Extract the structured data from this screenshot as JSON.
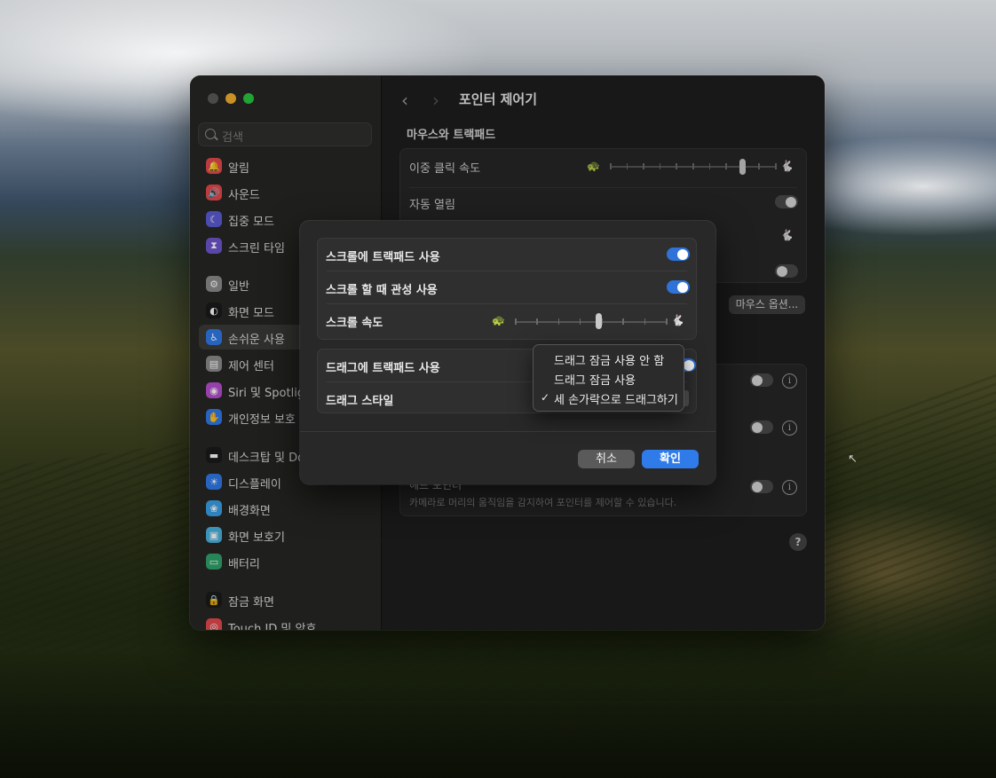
{
  "window": {
    "title": "포인터 제어기",
    "nav_back": "‹",
    "nav_forward": "›"
  },
  "sidebar": {
    "search_placeholder": "검색",
    "items": [
      {
        "label": "알림",
        "icon": "bell-icon",
        "color": "#e5484d"
      },
      {
        "label": "사운드",
        "icon": "speaker-icon",
        "color": "#e5484d"
      },
      {
        "label": "집중 모드",
        "icon": "moon-icon",
        "color": "#5b5bd6"
      },
      {
        "label": "스크린 타임",
        "icon": "hourglass-icon",
        "color": "#6e56cf"
      },
      {
        "label": "일반",
        "icon": "gear-icon",
        "color": "#8b8b8b"
      },
      {
        "label": "화면 모드",
        "icon": "appearance-icon",
        "color": "#1a1a1a"
      },
      {
        "label": "손쉬운 사용",
        "icon": "accessibility-icon",
        "color": "#2f7bea"
      },
      {
        "label": "제어 센터",
        "icon": "control-center-icon",
        "color": "#8b8b8b"
      },
      {
        "label": "Siri 및 Spotlight",
        "icon": "siri-icon",
        "color": "#b84fd1"
      },
      {
        "label": "개인정보 보호 및 보안",
        "icon": "hand-icon",
        "color": "#2f7bea"
      },
      {
        "label": "데스크탑 및 Dock",
        "icon": "dock-icon",
        "color": "#1a1a1a"
      },
      {
        "label": "디스플레이",
        "icon": "sun-icon",
        "color": "#2f7bea"
      },
      {
        "label": "배경화면",
        "icon": "wallpaper-icon",
        "color": "#3aa0e8"
      },
      {
        "label": "화면 보호기",
        "icon": "screensaver-icon",
        "color": "#4bb3e0"
      },
      {
        "label": "배터리",
        "icon": "battery-icon",
        "color": "#30a46c"
      },
      {
        "label": "잠금 화면",
        "icon": "lock-icon",
        "color": "#1a1a1a"
      },
      {
        "label": "Touch ID 및 암호",
        "icon": "fingerprint-icon",
        "color": "#e5484d"
      }
    ]
  },
  "main": {
    "section_title": "마우스와 트랙패드",
    "rows": {
      "double_click_speed": "이중 클릭 속도",
      "spring_loading": "자동 열림"
    },
    "mouse_options_button": "마우스 옵션...",
    "head_pointer_desc": "카메라로 머리의 움직임을 감지하여 포인터를 제어할 수 있습니다.",
    "head_pointer_partial": "헤드 포인터",
    "help": "?",
    "double_click_speed_value": 0.8
  },
  "sheet": {
    "rows": {
      "scroll_trackpad": "스크롤에 트랙패드 사용",
      "scroll_inertia": "스크롤 할 때 관성 사용",
      "scroll_speed": "스크롤 속도",
      "drag_trackpad": "드래그에 트랙패드 사용",
      "drag_style": "드래그 스타일"
    },
    "scroll_trackpad_on": true,
    "scroll_inertia_on": true,
    "scroll_speed_value": 0.55,
    "cancel": "취소",
    "ok": "확인"
  },
  "menu": {
    "items": [
      "드래그 잠금 사용 안 함",
      "드래그 잠금 사용",
      "세 손가락으로 드래그하기"
    ],
    "selected": "세 손가락으로 드래그하기",
    "checkmark": "✓"
  }
}
